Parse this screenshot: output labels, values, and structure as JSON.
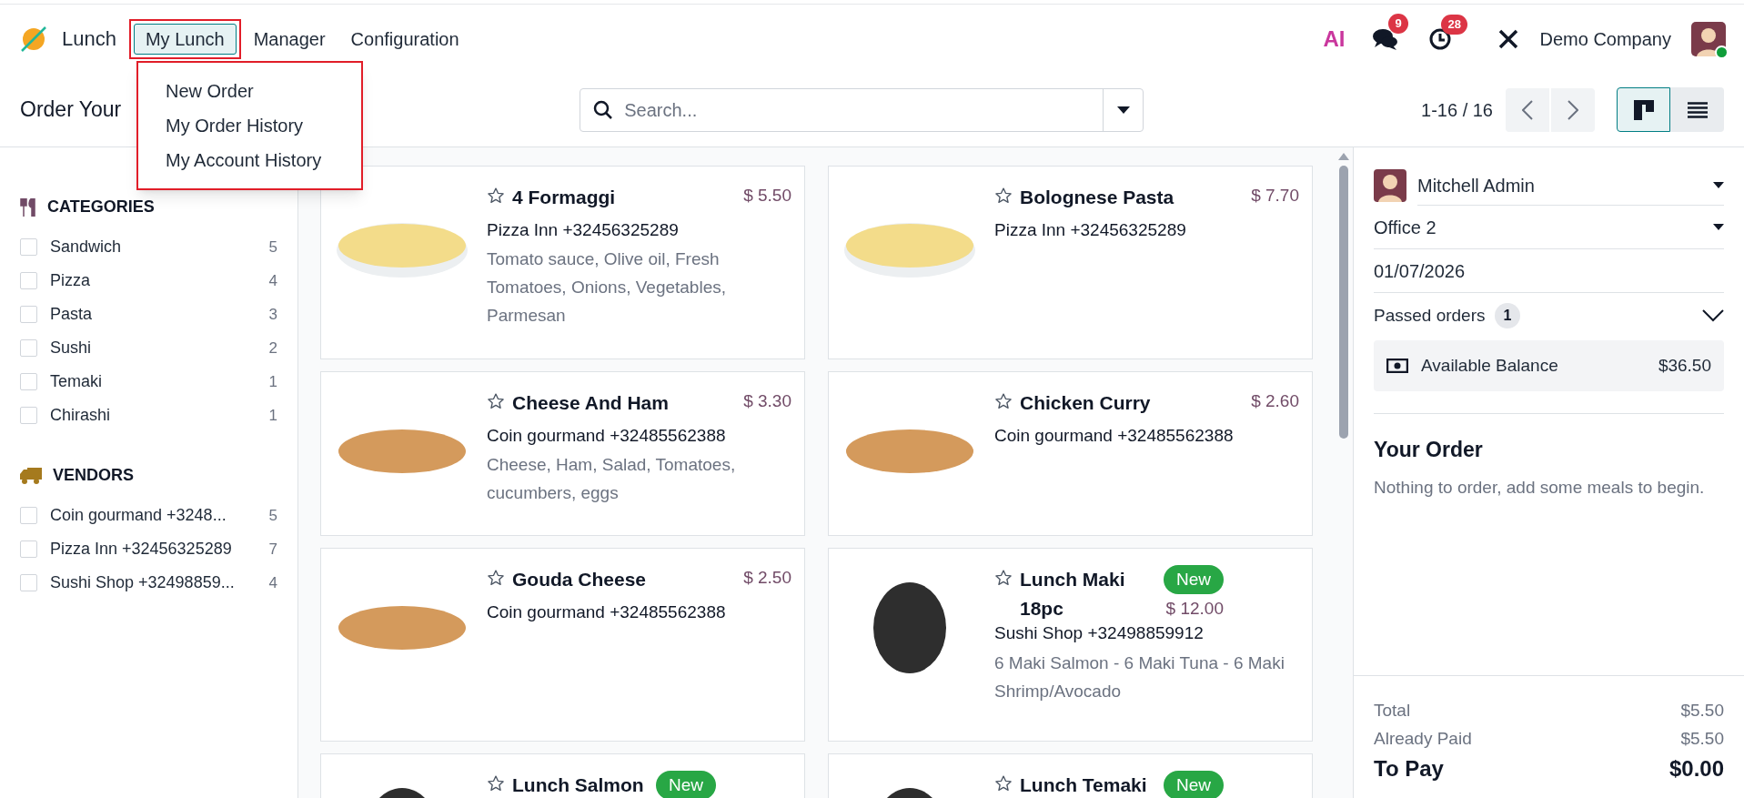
{
  "app": {
    "name": "Lunch"
  },
  "menu": [
    {
      "label": "My Lunch",
      "selected": true
    },
    {
      "label": "Manager",
      "selected": false
    },
    {
      "label": "Configuration",
      "selected": false
    }
  ],
  "dropdown": [
    "New Order",
    "My Order History",
    "My Account History"
  ],
  "systray": {
    "ai_label": "AI",
    "messages_count": "9",
    "activities_count": "28",
    "company": "Demo Company"
  },
  "page_title": "Order Your",
  "search": {
    "placeholder": "Search..."
  },
  "pager": "1-16 / 16",
  "views": [
    {
      "kind": "kanban",
      "selected": true
    },
    {
      "kind": "list",
      "selected": false
    }
  ],
  "categories": {
    "title": "CATEGORIES",
    "items": [
      {
        "label": "Sandwich",
        "count": "5",
        "checked": false
      },
      {
        "label": "Pizza",
        "count": "4",
        "checked": false
      },
      {
        "label": "Pasta",
        "count": "3",
        "checked": false
      },
      {
        "label": "Sushi",
        "count": "2",
        "checked": false
      },
      {
        "label": "Temaki",
        "count": "1",
        "checked": false
      },
      {
        "label": "Chirashi",
        "count": "1",
        "checked": false
      }
    ]
  },
  "vendors": {
    "title": "VENDORS",
    "items": [
      {
        "label": "Coin gourmand +3248...",
        "count": "5",
        "checked": false
      },
      {
        "label": "Pizza Inn +32456325289",
        "count": "7",
        "checked": false
      },
      {
        "label": "Sushi Shop +32498859...",
        "count": "4",
        "checked": false
      }
    ]
  },
  "products": [
    {
      "name": "4 Formaggi",
      "price": "$ 5.50",
      "vendor": "Pizza Inn +32456325289",
      "description": "Tomato sauce, Olive oil, Fresh Tomatoes, Onions, Vegetables, Parmesan",
      "favorite": false,
      "kind": "pasta"
    },
    {
      "name": "Bolognese Pasta",
      "price": "$ 7.70",
      "vendor": "Pizza Inn +32456325289",
      "favorite": false,
      "kind": "pasta"
    },
    {
      "name": "Cheese And Ham",
      "price": "$ 3.30",
      "vendor": "Coin gourmand +32485562388",
      "description": "Cheese, Ham, Salad, Tomatoes, cucumbers, eggs",
      "favorite": false,
      "kind": "sandwich"
    },
    {
      "name": "Chicken Curry",
      "price": "$ 2.60",
      "vendor": "Coin gourmand +32485562388",
      "favorite": false,
      "kind": "sandwich"
    },
    {
      "name": "Gouda Cheese",
      "price": "$ 2.50",
      "vendor": "Coin gourmand +32485562388",
      "favorite": false,
      "kind": "sandwich"
    },
    {
      "name": "Lunch Maki 18pc",
      "badge": "New",
      "price": "$ 12.00",
      "vendor": "Sushi Shop +32498859912",
      "description": "6 Maki Salmon - 6 Maki Tuna - 6 Maki Shrimp/Avocado",
      "favorite": false,
      "kind": "sushi"
    },
    {
      "name": "Lunch Salmon",
      "badge": "New",
      "favorite": false,
      "kind": "sushi"
    },
    {
      "name": "Lunch Temaki",
      "badge": "New",
      "favorite": false,
      "kind": "sushi"
    }
  ],
  "order_panel": {
    "user": "Mitchell Admin",
    "location": "Office 2",
    "date": "01/07/2026",
    "passed_orders": {
      "label": "Passed orders",
      "count": "1",
      "expanded": false
    },
    "balance": {
      "label": "Available Balance",
      "amount": "$36.50"
    },
    "title": "Your Order",
    "empty_text": "Nothing to order, add some meals to begin.",
    "totals": [
      {
        "label": "Total",
        "amount": "$5.50",
        "kind": "subtotal"
      },
      {
        "label": "Already Paid",
        "amount": "$5.50",
        "kind": "subtotal"
      },
      {
        "label": "To Pay",
        "amount": "$0.00",
        "kind": "grand"
      }
    ]
  }
}
